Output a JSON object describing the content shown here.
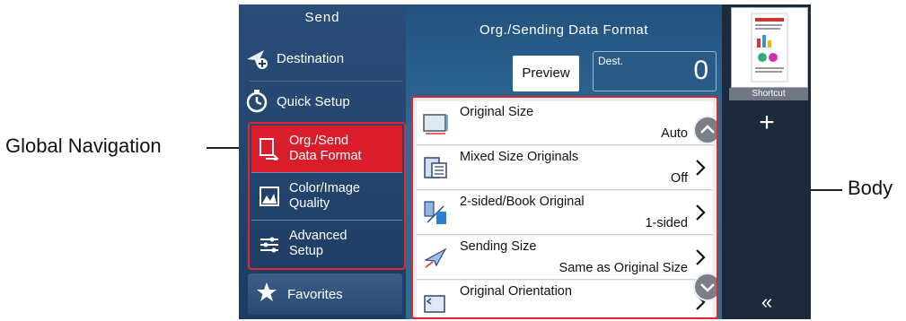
{
  "callouts": {
    "global_navigation": "Global Navigation",
    "body": "Body"
  },
  "nav": {
    "title": "Send",
    "destination": "Destination",
    "quick_setup": "Quick Setup",
    "org_send_line1": "Org./Send",
    "org_send_line2": "Data Format",
    "color_line1": "Color/Image",
    "color_line2": "Quality",
    "advanced_line1": "Advanced",
    "advanced_line2": "Setup",
    "favorites": "Favorites"
  },
  "center": {
    "title": "Org./Sending Data Format",
    "preview": "Preview",
    "dest_label": "Dest.",
    "dest_count": "0"
  },
  "settings": [
    {
      "name": "Original Size",
      "value": "Auto"
    },
    {
      "name": "Mixed Size Originals",
      "value": "Off"
    },
    {
      "name": "2-sided/Book Original",
      "value": "1-sided"
    },
    {
      "name": "Sending Size",
      "value": "Same as Original Size"
    },
    {
      "name": "Original Orientation",
      "value": ""
    }
  ],
  "right_panel": {
    "shortcut": "Shortcut",
    "add": "+",
    "collapse": "«"
  },
  "colors": {
    "accent_red": "#d91d2a",
    "nav_blue": "#1d3c63",
    "body_blue": "#2e6a96"
  },
  "icons": [
    "destination-icon",
    "quick-setup-icon",
    "org-send-icon",
    "color-image-icon",
    "advanced-setup-icon",
    "favorites-star-icon",
    "original-size-icon",
    "mixed-size-icon",
    "two-sided-icon",
    "sending-size-icon",
    "orientation-icon",
    "chevron-right-icon",
    "scroll-up-icon",
    "scroll-down-icon"
  ]
}
